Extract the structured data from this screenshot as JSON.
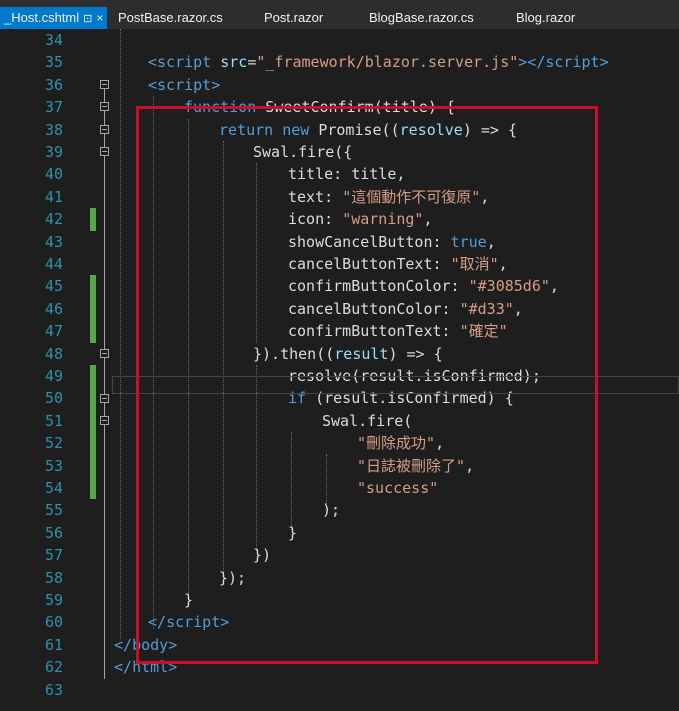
{
  "tabs": [
    {
      "label": "_Host.cshtml",
      "active": true
    },
    {
      "label": "PostBase.razor.cs",
      "active": false
    },
    {
      "label": "Post.razor",
      "active": false
    },
    {
      "label": "BlogBase.razor.cs",
      "active": false
    },
    {
      "label": "Blog.razor",
      "active": false
    }
  ],
  "tab_icons": {
    "pin": "⊡",
    "close": "×"
  },
  "line_numbers": [
    "34",
    "35",
    "36",
    "37",
    "38",
    "39",
    "40",
    "41",
    "42",
    "43",
    "44",
    "45",
    "46",
    "47",
    "48",
    "49",
    "50",
    "51",
    "52",
    "53",
    "54",
    "55",
    "56",
    "57",
    "58",
    "59",
    "60",
    "61",
    "62",
    "63"
  ],
  "code": {
    "l35": {
      "open": "<",
      "tag1": "script",
      "attr": " src",
      "eq": "=",
      "val": "\"_framework/blazor.server.js\"",
      "close1": "></",
      "tag2": "script",
      "close2": ">"
    },
    "l36": {
      "open": "<",
      "tag": "script",
      "close": ">"
    },
    "l37": {
      "kw": "function",
      "rest": " SweetConfirm(title) {"
    },
    "l38": {
      "kw1": "return",
      "sp": " ",
      "kw2": "new",
      "rest1": " Promise((",
      "param": "resolve",
      "rest2": ") => {"
    },
    "l39": {
      "text": "Swal.fire({"
    },
    "l40": {
      "text": "title: title,"
    },
    "l41": {
      "key": "text: ",
      "val": "\"這個動作不可復原\"",
      "end": ","
    },
    "l42": {
      "key": "icon: ",
      "val": "\"warning\"",
      "end": ","
    },
    "l43": {
      "key": "showCancelButton: ",
      "val": "true",
      "end": ","
    },
    "l44": {
      "key": "cancelButtonText: ",
      "val": "\"取消\"",
      "end": ","
    },
    "l45": {
      "key": "confirmButtonColor: ",
      "val": "\"#3085d6\"",
      "end": ","
    },
    "l46": {
      "key": "cancelButtonColor: ",
      "val": "\"#d33\"",
      "end": ","
    },
    "l47": {
      "key": "confirmButtonText: ",
      "val": "\"確定\""
    },
    "l48": {
      "a": "}).then((",
      "param": "result",
      "b": ") => {"
    },
    "l49": {
      "text": "resolve(result.isConfirmed);"
    },
    "l50": {
      "kw": "if",
      "rest": " (result.isConfirmed) {"
    },
    "l51": {
      "text": "Swal.fire("
    },
    "l52": {
      "val": "\"刪除成功\"",
      "end": ","
    },
    "l53": {
      "val": "\"日誌被刪除了\"",
      "end": ","
    },
    "l54": {
      "val": "\"success\""
    },
    "l55": {
      "text": ");"
    },
    "l56": {
      "text": "}"
    },
    "l57": {
      "text": "})"
    },
    "l58": {
      "text": "});"
    },
    "l59": {
      "text": "}"
    },
    "l60": {
      "open": "</",
      "tag": "script",
      "close": ">"
    },
    "l61": {
      "open": "</",
      "tag": "body",
      "close": ">"
    },
    "l62": {
      "open": "</",
      "tag": "html",
      "close": ">"
    }
  },
  "colors": {
    "tag": "#569cd6",
    "string": "#d69d85",
    "keyword": "#569cd6",
    "attribute": "#9cdcfe",
    "highlight_box": "#c8102e",
    "line_number": "#2b91af",
    "change_marker": "#57a64a"
  }
}
